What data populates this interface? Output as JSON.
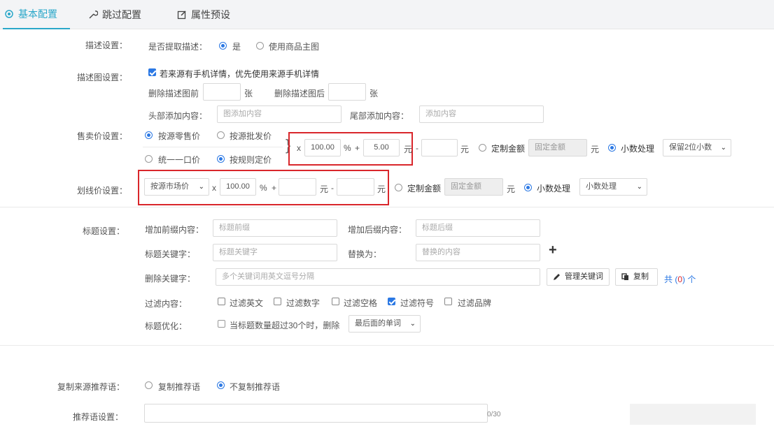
{
  "tabs": [
    {
      "label": "基本配置",
      "icon": "settings-icon"
    },
    {
      "label": "跳过配置",
      "icon": "wrench-icon"
    },
    {
      "label": "属性预设",
      "icon": "edit-icon"
    }
  ],
  "desc": {
    "label": "描述设置：",
    "question": "是否提取描述：",
    "opt_yes": "是",
    "opt_main": "使用商品主图"
  },
  "descimg": {
    "label": "描述图设置：",
    "mobile_first": "若来源有手机详情，优先使用来源手机详情",
    "del_first": "删除描述图前",
    "unit1": "张",
    "del_last": "删除描述图后",
    "unit2": "张",
    "head_add": "头部添加内容：",
    "head_ph": "图添加内容",
    "tail_add": "尾部添加内容：",
    "tail_ph": "添加内容"
  },
  "saleprice": {
    "label": "售卖价设置：",
    "opt_source_price": "按源零售价",
    "opt_buy_price": "按源批发价",
    "opt_fixed": "统一一口价",
    "opt_adjust": "按规则定价",
    "x": "x",
    "multiplier": "100.00",
    "percent": "%",
    "plus": "+",
    "add": "5.00",
    "yuan1": "元",
    "minus": "-",
    "yuan2": "元",
    "fixed_amount": "定制金额",
    "fixed_ph": "固定金额",
    "yuan3": "元",
    "decimal": "小数处理",
    "decimal_select": "保留2位小数"
  },
  "dropprice": {
    "label": "划线价设置：",
    "base_select": "按源市场价",
    "x": "x",
    "multiplier": "100.00",
    "percent": "%",
    "plus": "+",
    "yuan1": "元",
    "minus": "-",
    "yuan2": "元",
    "fixed_amount": "定制金额",
    "fixed_ph": "固定金额",
    "yuan3": "元",
    "decimal": "小数处理",
    "decimal_select": "小数处理"
  },
  "title": {
    "label": "标题设置：",
    "prefix": "增加前缀内容：",
    "prefix_ph": "标题前缀",
    "suffix": "增加后缀内容：",
    "suffix_ph": "标题后缀",
    "keyword": "标题关键字：",
    "keyword_ph": "标题关键字",
    "replace": "替换为：",
    "replace_ph": "替换的内容",
    "plus": "+",
    "remove_kw": "删除关键字：",
    "remove_ph": "多个关键词用英文逗号分隔",
    "manage_btn": "管理关键词",
    "copy_btn": "复制",
    "count_pre": "共 (",
    "count": "0",
    "count_post": ") 个",
    "filter_label": "过滤内容：",
    "filters": [
      {
        "label": "过滤英文",
        "checked": false
      },
      {
        "label": "过滤数字",
        "checked": false
      },
      {
        "label": "过滤空格",
        "checked": false
      },
      {
        "label": "过滤符号",
        "checked": true
      },
      {
        "label": "过滤品牌",
        "checked": false
      }
    ],
    "optimize_label": "标题优化：",
    "optimize_text": "当标题数量超过30个时，删除",
    "optimize_select": "最后面的单词"
  },
  "recommend": {
    "label": "复制来源推荐语：",
    "opt_copy": "复制推荐语",
    "opt_nocopy": "不复制推荐语"
  },
  "recomm_set": {
    "label": "推荐语设置：",
    "counter": "0/30"
  }
}
